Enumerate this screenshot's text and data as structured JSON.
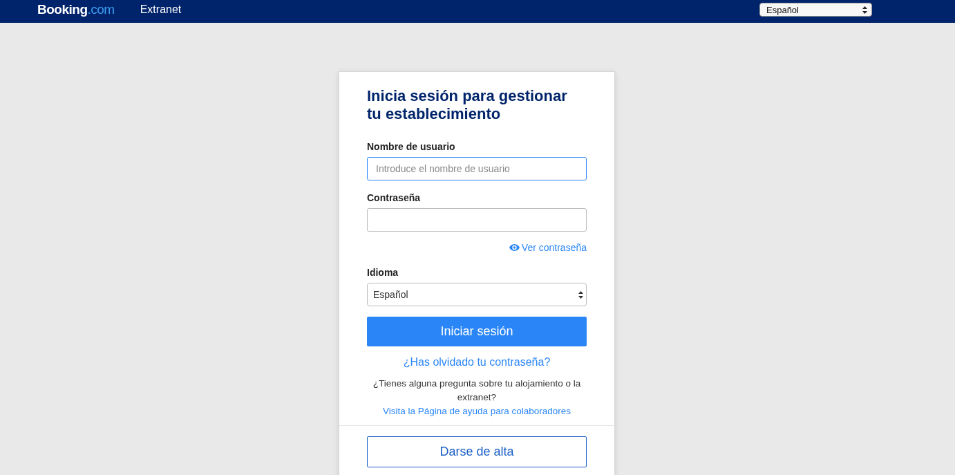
{
  "header": {
    "logo": {
      "brand": "Booking",
      "domain": ".com"
    },
    "product": "Extranet",
    "language_select": {
      "value": "Español"
    }
  },
  "login": {
    "title": "Inicia sesión para gestionar tu establecimiento",
    "fields": [
      {
        "label": "Nombre de usuario",
        "placeholder": "Introduce el nombre de usuario",
        "focused": true
      },
      {
        "label": "Contraseña",
        "focused": false
      }
    ],
    "show_password": "Ver contraseña",
    "language": {
      "label": "Idioma",
      "value": "Español"
    },
    "submit": "Iniciar sesión",
    "forgot": "¿Has olvidado tu contraseña?",
    "help_text": "¿Tienes alguna pregunta sobre tu alojamiento o la extranet?",
    "help_link": "Visita la Página de ayuda para colaboradores",
    "register": "Darse de alta"
  }
}
